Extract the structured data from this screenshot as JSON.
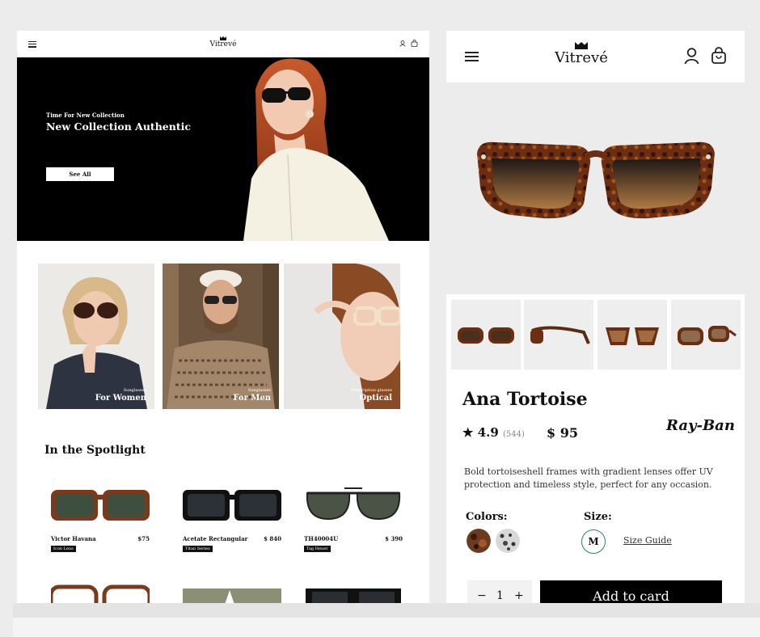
{
  "brand": {
    "name": "Vitrevé"
  },
  "left": {
    "hero": {
      "kicker": "Time For New Collection",
      "headline": "New Collection Authentic",
      "cta": "See All"
    },
    "categories": [
      {
        "sub": "Sunglasses",
        "label": "For Women"
      },
      {
        "sub": "Sunglasses",
        "label": "For Men"
      },
      {
        "sub": "Prescription glasses",
        "label": "Optical"
      }
    ],
    "spotlight_title": "In the Spotlight",
    "products": [
      {
        "name": "Victor Havana",
        "price": "$75",
        "tag": "Icon Lens"
      },
      {
        "name": "Acetate Rectangular",
        "price": "$ 840",
        "tag": "Titan Series"
      },
      {
        "name": "TH40004U",
        "price": "$ 390",
        "tag": "Tag Heuer"
      }
    ]
  },
  "right": {
    "product_name": "Ana Tortoise",
    "rating": "4.9",
    "rating_count": "(544)",
    "price": "$ 95",
    "brand_logo_text": "Ray-Ban",
    "description": "Bold tortoiseshell frames with gradient lenses offer UV protection and timeless style, perfect for any occasion.",
    "colors_label": "Colors:",
    "size_label": "Size:",
    "size_value": "M",
    "size_guide": "Size Guide",
    "qty_minus": "−",
    "qty_value": "1",
    "qty_plus": "+",
    "add_to_cart": "Add to card",
    "colors": [
      "#6b3a1f",
      "#d8d8d8"
    ]
  }
}
